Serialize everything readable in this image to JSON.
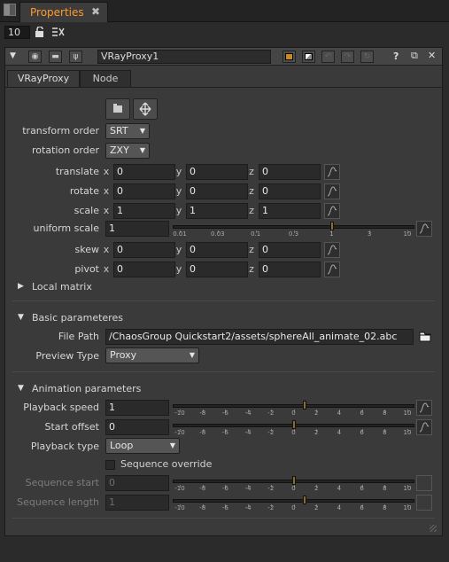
{
  "app": {
    "panel_tab": "Properties",
    "frame_value": "10"
  },
  "node": {
    "name": "VRayProxy1",
    "tabs": [
      "VRayProxy",
      "Node"
    ]
  },
  "transform": {
    "transform_order": {
      "label": "transform order",
      "value": "SRT"
    },
    "rotation_order": {
      "label": "rotation order",
      "value": "ZXY"
    },
    "translate": {
      "label": "translate",
      "x": "0",
      "y": "0",
      "z": "0"
    },
    "rotate": {
      "label": "rotate",
      "x": "0",
      "y": "0",
      "z": "0"
    },
    "scale": {
      "label": "scale",
      "x": "1",
      "y": "1",
      "z": "1"
    },
    "uniform_scale": {
      "label": "uniform scale",
      "value": "1",
      "ticks": [
        "0.01",
        "0.03",
        "0.1",
        "0.3",
        "1",
        "3",
        "10"
      ]
    },
    "skew": {
      "label": "skew",
      "x": "0",
      "y": "0",
      "z": "0"
    },
    "pivot": {
      "label": "pivot",
      "x": "0",
      "y": "0",
      "z": "0"
    },
    "local_matrix": "Local matrix"
  },
  "basic": {
    "title": "Basic parameteres",
    "file_path": {
      "label": "File Path",
      "value": "/ChaosGroup Quickstart2/assets/sphereAll_animate_02.abc"
    },
    "preview_type": {
      "label": "Preview Type",
      "value": "Proxy"
    }
  },
  "animation": {
    "title": "Animation parameters",
    "playback_speed": {
      "label": "Playback speed",
      "value": "1"
    },
    "start_offset": {
      "label": "Start offset",
      "value": "0"
    },
    "playback_type": {
      "label": "Playback type",
      "value": "Loop"
    },
    "sequence_override": "Sequence override",
    "sequence_start": {
      "label": "Sequence start",
      "value": "0"
    },
    "sequence_length": {
      "label": "Sequence length",
      "value": "1"
    },
    "ticks": [
      "-10",
      "-8",
      "-6",
      "-4",
      "-2",
      "0",
      "2",
      "4",
      "6",
      "8",
      "10"
    ]
  },
  "axis_labels": {
    "x": "x",
    "y": "y",
    "z": "z"
  }
}
